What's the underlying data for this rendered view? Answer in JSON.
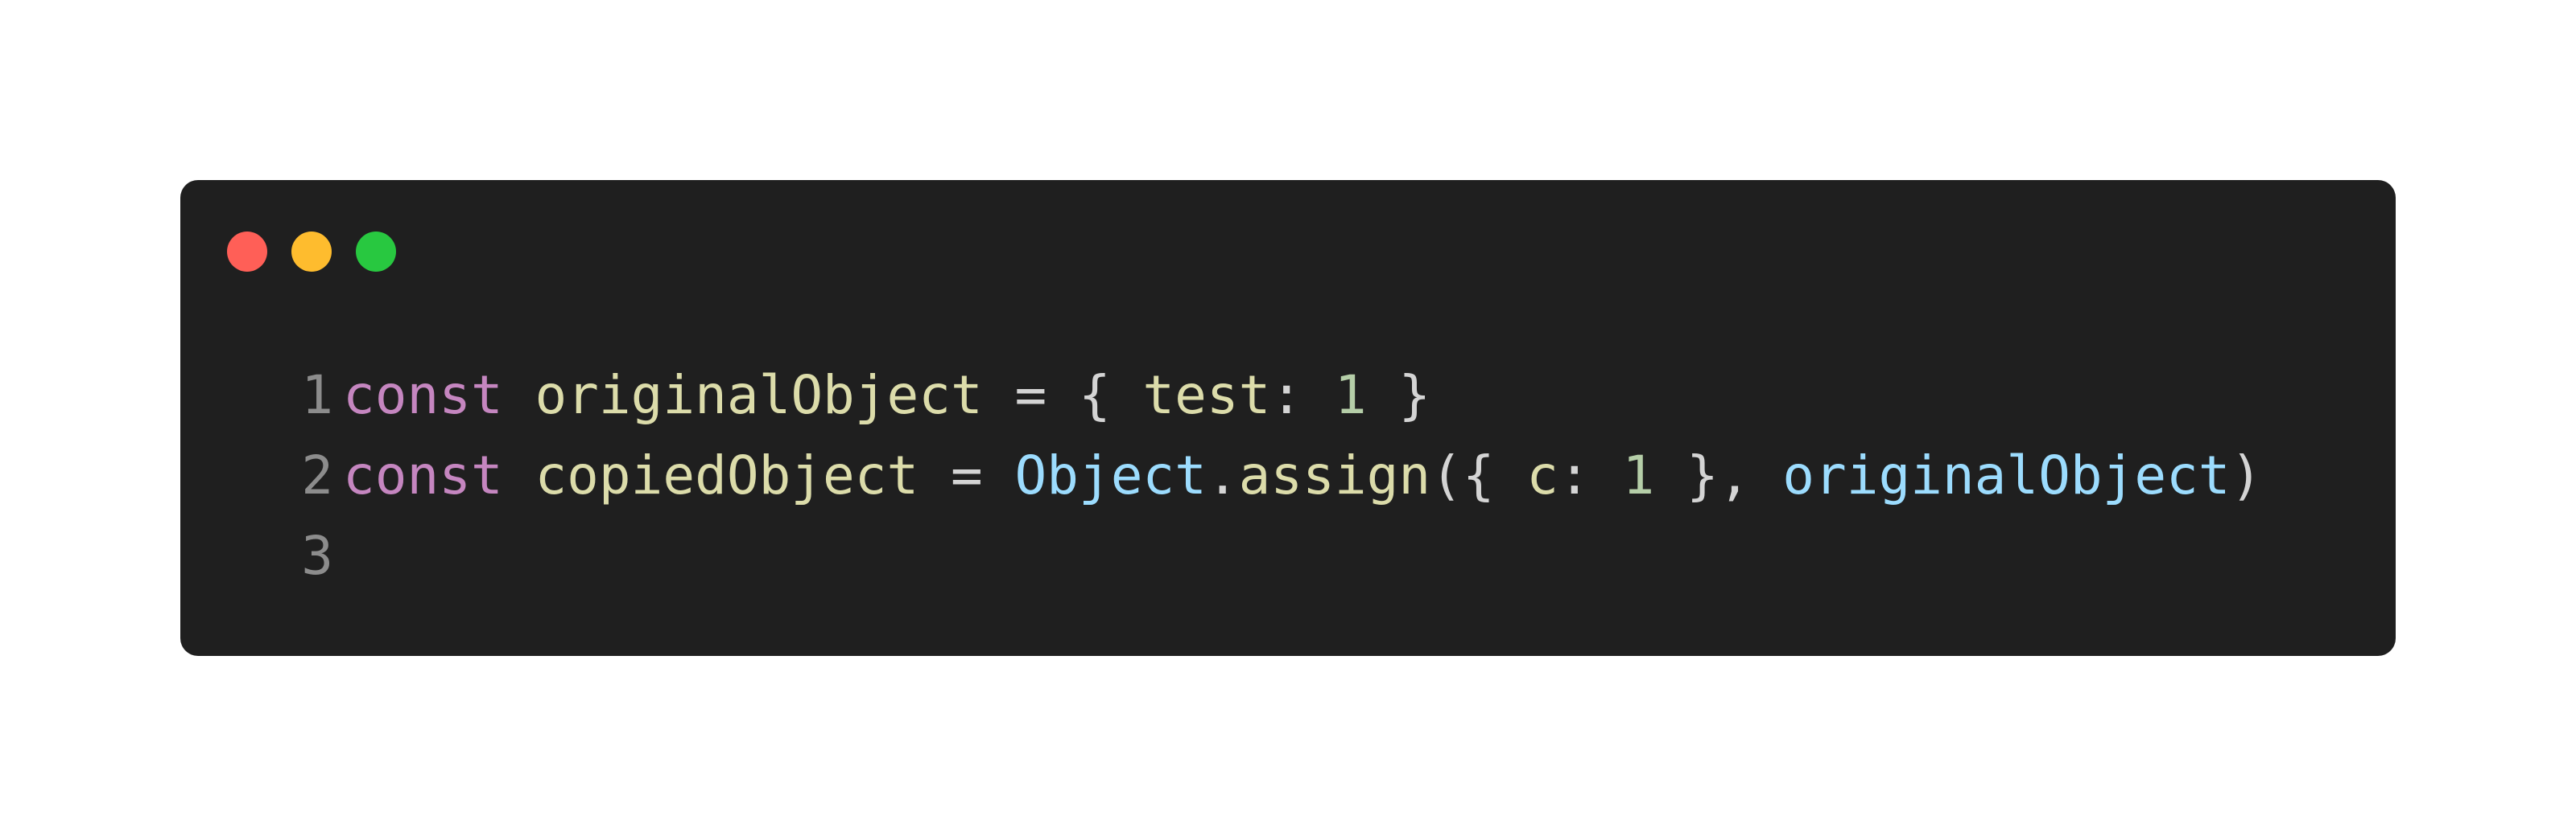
{
  "colors": {
    "page_background": "#ffffff",
    "window_background": "#1f1f1f",
    "light_red": "#ff5f57",
    "light_yellow": "#febc2e",
    "light_green": "#28c840",
    "line_number": "#8c8c8c",
    "keyword": "#c586c0",
    "identifier": "#dcdcaa",
    "punctuation": "#d4d4d4",
    "number": "#b5cea8",
    "type": "#9cdcfe"
  },
  "window_controls": [
    "close-light",
    "minimize-light",
    "zoom-light"
  ],
  "code_lines": [
    {
      "number": "1",
      "tokens": [
        {
          "text": "const",
          "kind": "keyword"
        },
        {
          "text": " ",
          "kind": "punctuation"
        },
        {
          "text": "originalObject",
          "kind": "identifier"
        },
        {
          "text": " = { ",
          "kind": "punctuation"
        },
        {
          "text": "test",
          "kind": "identifier"
        },
        {
          "text": ": ",
          "kind": "punctuation"
        },
        {
          "text": "1",
          "kind": "number"
        },
        {
          "text": " }",
          "kind": "punctuation"
        }
      ]
    },
    {
      "number": "2",
      "tokens": [
        {
          "text": "const",
          "kind": "keyword"
        },
        {
          "text": " ",
          "kind": "punctuation"
        },
        {
          "text": "copiedObject",
          "kind": "identifier"
        },
        {
          "text": " = ",
          "kind": "punctuation"
        },
        {
          "text": "Object",
          "kind": "type"
        },
        {
          "text": ".",
          "kind": "punctuation"
        },
        {
          "text": "assign",
          "kind": "identifier"
        },
        {
          "text": "({ ",
          "kind": "punctuation"
        },
        {
          "text": "c",
          "kind": "identifier"
        },
        {
          "text": ": ",
          "kind": "punctuation"
        },
        {
          "text": "1",
          "kind": "number"
        },
        {
          "text": " }, ",
          "kind": "punctuation"
        },
        {
          "text": "originalObject",
          "kind": "type"
        },
        {
          "text": ")",
          "kind": "punctuation"
        }
      ]
    },
    {
      "number": "3",
      "tokens": []
    }
  ]
}
